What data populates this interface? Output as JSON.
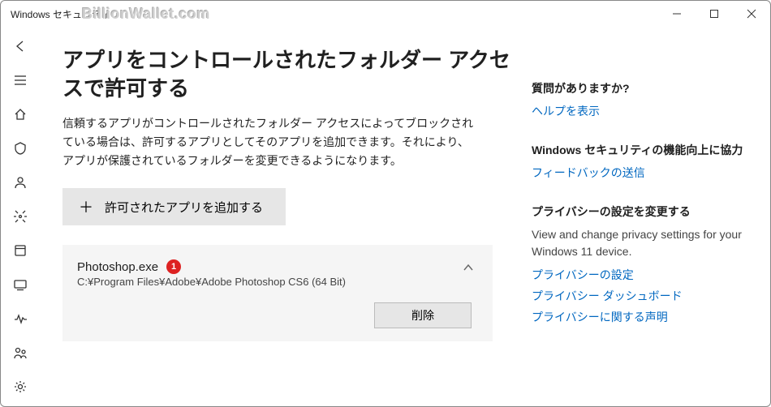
{
  "window": {
    "title": "Windows セキュリティ",
    "watermark": "BillionWallet.com"
  },
  "page": {
    "heading": "アプリをコントロールされたフォルダー アクセスで許可する",
    "description": "信頼するアプリがコントロールされたフォルダー アクセスによってブロックされている場合は、許可するアプリとしてそのアプリを追加できます。それにより、アプリが保護されているフォルダーを変更できるようになります。",
    "add_button_label": "許可されたアプリを追加する"
  },
  "allowed_app": {
    "name": "Photoshop.exe",
    "badge": "1",
    "path": "C:¥Program Files¥Adobe¥Adobe Photoshop CS6 (64 Bit)",
    "remove_label": "削除"
  },
  "right": {
    "help_heading": "質問がありますか?",
    "help_link": "ヘルプを表示",
    "feedback_heading": "Windows セキュリティの機能向上に協力",
    "feedback_link": "フィードバックの送信",
    "privacy_heading": "プライバシーの設定を変更する",
    "privacy_text": "View and change privacy settings for your Windows 11 device.",
    "privacy_link1": "プライバシーの設定",
    "privacy_link2": "プライバシー ダッシュボード",
    "privacy_link3": "プライバシーに関する声明"
  }
}
